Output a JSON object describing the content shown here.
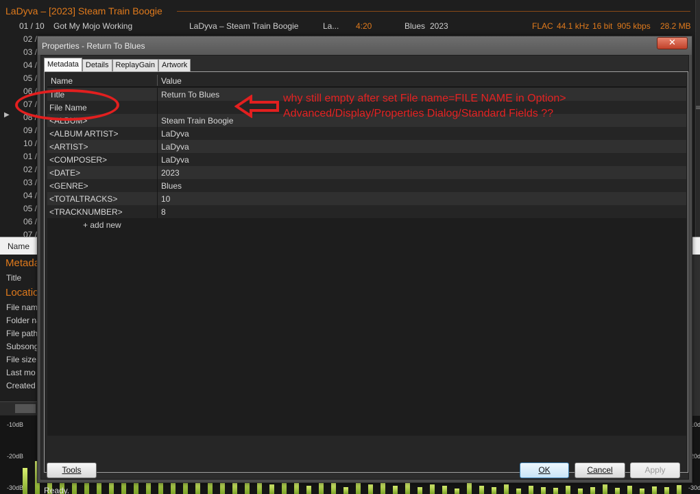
{
  "background_app": {
    "album_header": "LaDyva – [2023] Steam Train Boogie",
    "first_row": {
      "track": "01 / 10",
      "title": "Got My Mojo Working",
      "album": "LaDyva – Steam Train Boogie",
      "artist": "La...",
      "duration": "4:20",
      "genre": "Blues",
      "year": "2023",
      "codec": "FLAC",
      "samplerate": "44.1 kHz",
      "bitdepth": "16 bit",
      "bitrate": "905 kbps",
      "size": "28.2 MB"
    },
    "track_numbers": [
      "02 /",
      "03 /",
      "04 /",
      "05 /",
      "06 /",
      "07 /",
      "08 /",
      "09 /",
      "10 /",
      "01 /",
      "02 /",
      "03 /",
      "04 /",
      "05 /",
      "06 /",
      "07 /"
    ],
    "name_column": "Name",
    "section_metadata": "Metadat",
    "field_title": "Title",
    "section_location": "Location",
    "location_fields": [
      "File nam",
      "Folder na",
      "File path",
      "Subsong",
      "File size",
      "Last mo",
      "Created"
    ],
    "db_labels": [
      "-10dB",
      "-20dB",
      "-30dB"
    ],
    "db_labels_right": [
      "-10d",
      "-20d",
      "-30d"
    ]
  },
  "dialog": {
    "title": "Properties - Return To Blues",
    "close_glyph": "✕",
    "tabs": [
      "Metadata",
      "Details",
      "ReplayGain",
      "Artwork"
    ],
    "columns": {
      "name": "Name",
      "value": "Value"
    },
    "rows": [
      {
        "name": "Title",
        "value": "Return To Blues"
      },
      {
        "name": "File Name",
        "value": ""
      },
      {
        "name": "<ALBUM>",
        "value": "Steam Train Boogie"
      },
      {
        "name": "<ALBUM ARTIST>",
        "value": "LaDyva"
      },
      {
        "name": "<ARTIST>",
        "value": "LaDyva"
      },
      {
        "name": "<COMPOSER>",
        "value": "LaDyva"
      },
      {
        "name": "<DATE>",
        "value": "2023"
      },
      {
        "name": "<GENRE>",
        "value": "Blues"
      },
      {
        "name": "<TOTALTRACKS>",
        "value": "10"
      },
      {
        "name": "<TRACKNUMBER>",
        "value": "8"
      }
    ],
    "add_new": "+ add new",
    "buttons": {
      "tools": "Tools",
      "ok": "OK",
      "cancel": "Cancel",
      "apply": "Apply"
    },
    "status": "Ready."
  },
  "annotation": {
    "line1": "why still empty after set File name=FILE NAME in Option>",
    "line2": "Advanced/Display/Properties Dialog/Standard Fields ??",
    "color": "#e42222"
  },
  "colors": {
    "accent_orange": "#e07a1c",
    "annotation_red": "#e21f1f"
  }
}
